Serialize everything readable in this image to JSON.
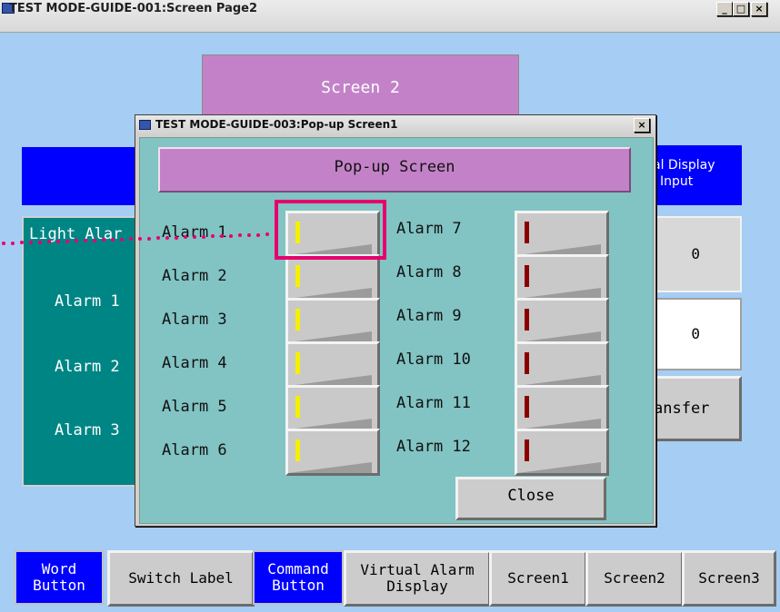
{
  "main_window": {
    "title": "TEST MODE-GUIDE-001:Screen Page2",
    "controls": {
      "minimize": "_",
      "maximize": "□",
      "close": "×"
    }
  },
  "background_screen": {
    "screen_title": "Screen 2",
    "light_alarm_title": "Light Alar",
    "light_alarm_items": [
      "Alarm 1",
      "Alarm 2",
      "Alarm 3"
    ],
    "virtual_display_label_line1": "al Display",
    "virtual_display_label_line2": "Input",
    "value_1": "0",
    "value_2": "0",
    "transfer_label": "ansfer"
  },
  "popup": {
    "title": "TEST MODE-GUIDE-003:Pop-up Screen1",
    "close_glyph": "×",
    "header": "Pop-up Screen",
    "alarms_left": [
      "Alarm 1",
      "Alarm 2",
      "Alarm 3",
      "Alarm 4",
      "Alarm 5",
      "Alarm 6"
    ],
    "alarms_right": [
      "Alarm  7",
      "Alarm 8",
      "Alarm 9",
      "Alarm 10",
      "Alarm 11",
      "Alarm 12"
    ],
    "close_button": "Close",
    "lamp_colors": {
      "left": "#f5f000",
      "right": "#8a0000"
    }
  },
  "bottom_bar": [
    {
      "line1": "Word",
      "line2": "Button",
      "style": "blue"
    },
    {
      "line1": "Switch Label",
      "line2": "",
      "style": "gray"
    },
    {
      "line1": "Command",
      "line2": "Button",
      "style": "blue"
    },
    {
      "line1": "Virtual Alarm",
      "line2": "Display",
      "style": "gray"
    },
    {
      "line1": "Screen1",
      "line2": "",
      "style": "gray"
    },
    {
      "line1": "Screen2",
      "line2": "",
      "style": "gray"
    },
    {
      "line1": "Screen3",
      "line2": "",
      "style": "gray"
    }
  ],
  "colors": {
    "annotation": "#e6006e",
    "teal_panel": "#008585",
    "popup_bg": "#82c3c3",
    "header_purple": "#c382c8"
  }
}
